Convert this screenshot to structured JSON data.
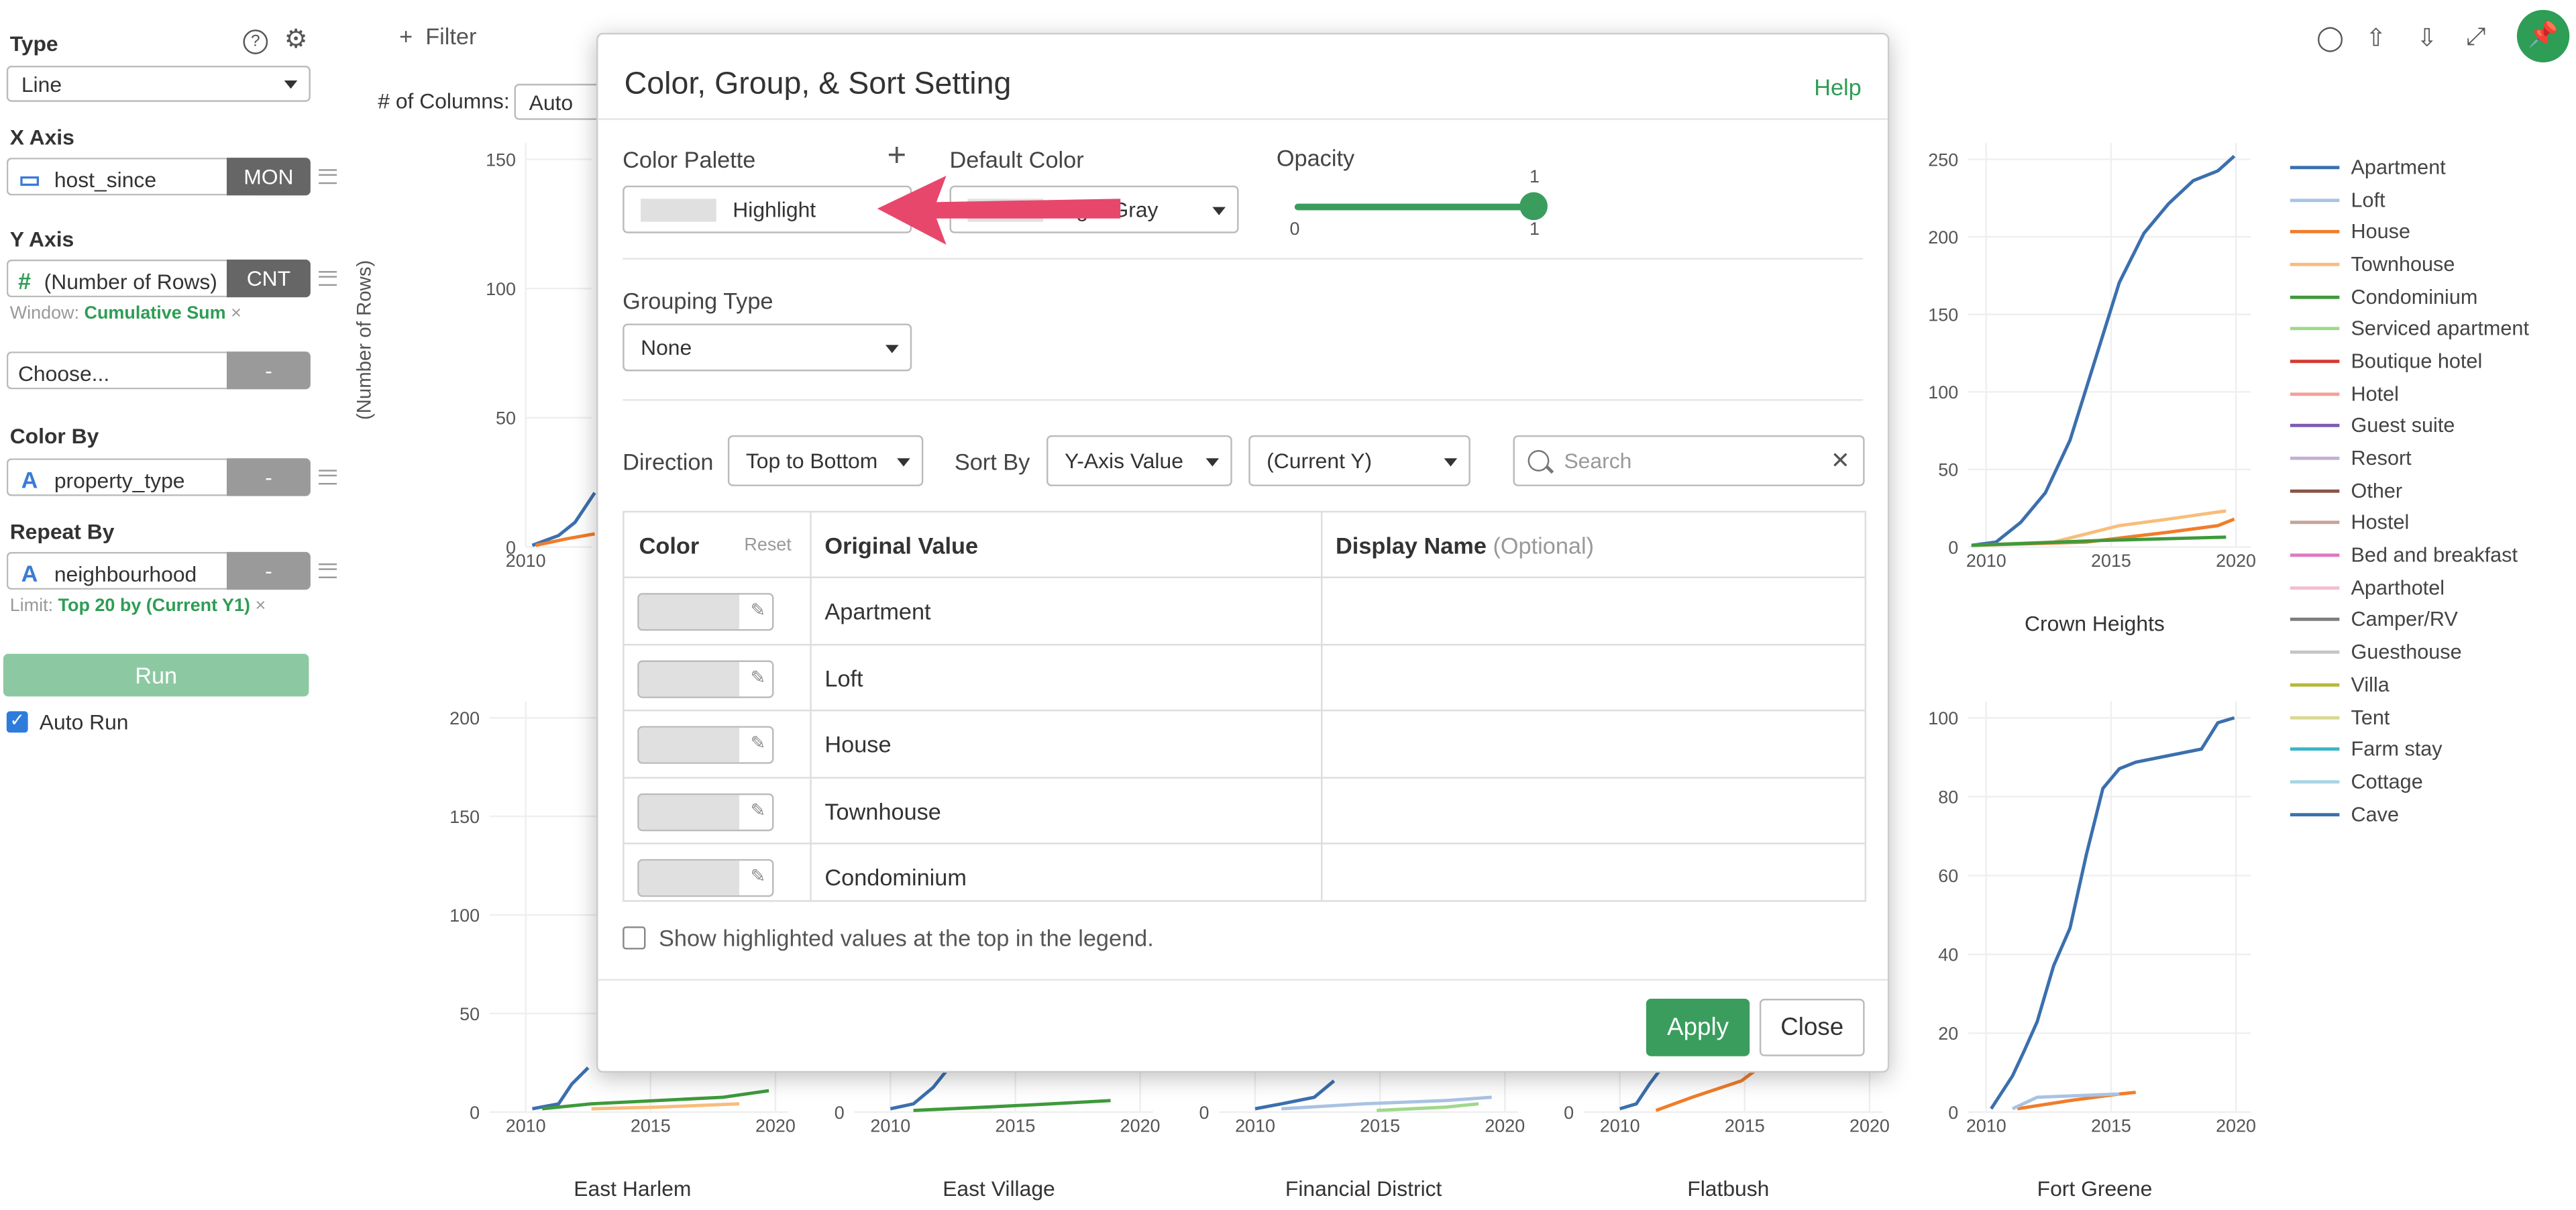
{
  "sidebar": {
    "type_label": "Type",
    "type_value": "Line",
    "x_axis_label": "X Axis",
    "x_field": "host_since",
    "x_agg": "MON",
    "y_axis_label": "Y Axis",
    "y_field": "(Number of Rows)",
    "y_agg": "CNT",
    "window_prefix": "Window:",
    "window_value": "Cumulative Sum",
    "choose_placeholder": "Choose...",
    "choose_agg": "-",
    "color_by_label": "Color By",
    "color_field": "property_type",
    "color_agg": "-",
    "repeat_by_label": "Repeat By",
    "repeat_field": "neighbourhood",
    "repeat_agg": "-",
    "limit_prefix": "Limit:",
    "limit_value": "Top 20 by (Current Y1)",
    "run_label": "Run",
    "auto_run_label": "Auto Run",
    "auto_run_checked": true
  },
  "topbar": {
    "filter_label": "Filter",
    "columns_label": "# of Columns:",
    "columns_value": "Auto"
  },
  "charts": {
    "y_axis_title": "(Number of Rows)",
    "panels": [
      {
        "title": "",
        "yticks": [
          "150",
          "100",
          "50",
          "0"
        ],
        "xticks": [
          "2010"
        ]
      },
      {
        "title": "Crown Heights",
        "yticks": [
          "250",
          "200",
          "150",
          "100",
          "50",
          "0"
        ],
        "xticks": [
          "2010",
          "2015",
          "2020"
        ]
      },
      {
        "title": "East Harlem",
        "yticks": [
          "200",
          "150",
          "100",
          "50",
          "0"
        ],
        "xticks": [
          "2010",
          "2015",
          "2020"
        ]
      },
      {
        "title": "East Village",
        "yticks": [
          "0"
        ],
        "xticks": [
          "2010",
          "2015",
          "2020"
        ]
      },
      {
        "title": "Financial District",
        "yticks": [
          "0"
        ],
        "xticks": [
          "2010",
          "2015",
          "2020"
        ]
      },
      {
        "title": "Flatbush",
        "yticks": [
          "0"
        ],
        "xticks": [
          "2010",
          "2015",
          "2020"
        ]
      },
      {
        "title": "Fort Greene",
        "yticks": [
          "100",
          "80",
          "60",
          "40",
          "20",
          "0"
        ],
        "xticks": [
          "2010",
          "2015",
          "2020"
        ]
      }
    ]
  },
  "legend": [
    {
      "label": "Apartment",
      "color": "#3b6fae"
    },
    {
      "label": "Loft",
      "color": "#a8c3e3"
    },
    {
      "label": "House",
      "color": "#f07d2a"
    },
    {
      "label": "Townhouse",
      "color": "#f8bd7b"
    },
    {
      "label": "Condominium",
      "color": "#3e9a3b"
    },
    {
      "label": "Serviced apartment",
      "color": "#a1d88c"
    },
    {
      "label": "Boutique hotel",
      "color": "#d5392f"
    },
    {
      "label": "Hotel",
      "color": "#f4a09a"
    },
    {
      "label": "Guest suite",
      "color": "#7e5bb5"
    },
    {
      "label": "Resort",
      "color": "#c2b0d8"
    },
    {
      "label": "Other",
      "color": "#8b5446"
    },
    {
      "label": "Hostel",
      "color": "#c5a39a"
    },
    {
      "label": "Bed and breakfast",
      "color": "#de79c0"
    },
    {
      "label": "Aparthotel",
      "color": "#f5bcd4"
    },
    {
      "label": "Camper/RV",
      "color": "#7d7d7d"
    },
    {
      "label": "Guesthouse",
      "color": "#c5c5c5"
    },
    {
      "label": "Villa",
      "color": "#b5b73a"
    },
    {
      "label": "Tent",
      "color": "#d9d990"
    },
    {
      "label": "Farm stay",
      "color": "#3bb5c8"
    },
    {
      "label": "Cottage",
      "color": "#a6d6e2"
    },
    {
      "label": "Cave",
      "color": "#3b6fae"
    }
  ],
  "modal": {
    "title": "Color, Group, & Sort Setting",
    "help_label": "Help",
    "palette_label": "Color Palette",
    "palette_value": "Highlight",
    "default_color_label": "Default Color",
    "default_color_value": "Light Gray",
    "opacity_label": "Opacity",
    "opacity_value_top": "1",
    "opacity_min": "0",
    "opacity_max": "1",
    "opacity": 1,
    "grouping_label": "Grouping Type",
    "grouping_value": "None",
    "direction_label": "Direction",
    "direction_value": "Top to Bottom",
    "sort_by_label": "Sort By",
    "sort_by_value": "Y-Axis Value",
    "sort_target_value": "(Current Y)",
    "search_placeholder": "Search",
    "table": {
      "col_color": "Color",
      "col_reset": "Reset",
      "col_original": "Original Value",
      "col_display": "Display Name",
      "col_display_optional": "(Optional)",
      "rows": [
        {
          "value": "Apartment"
        },
        {
          "value": "Loft"
        },
        {
          "value": "House"
        },
        {
          "value": "Townhouse"
        },
        {
          "value": "Condominium"
        }
      ]
    },
    "show_highlighted_label": "Show highlighted values at the top in the legend.",
    "apply_label": "Apply",
    "close_label": "Close",
    "swatch_color": "#e0e0e0",
    "accent_color": "#3a9d5e"
  }
}
